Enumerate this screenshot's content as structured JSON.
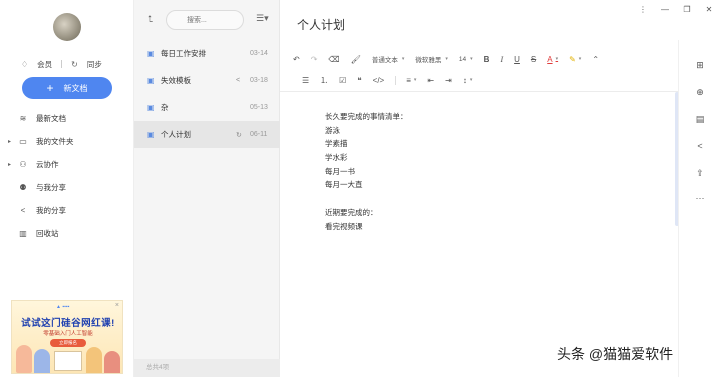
{
  "sidebar": {
    "vip_label": "会员",
    "sync_label": "同步",
    "new_doc_label": "新文档",
    "nav": [
      {
        "label": "最新文档",
        "icon": "layers-icon"
      },
      {
        "label": "我的文件夹",
        "icon": "folder-icon"
      },
      {
        "label": "云协作",
        "icon": "person-icon"
      },
      {
        "label": "与我分享",
        "icon": "people-icon"
      },
      {
        "label": "我的分享",
        "icon": "share-icon"
      },
      {
        "label": "回收站",
        "icon": "trash-icon"
      }
    ],
    "ad": {
      "title": "试试这门硅谷网红课!",
      "subtitle": "零基础入门人工智能",
      "button": "立即报名"
    }
  },
  "list": {
    "search_placeholder": "搜索...",
    "docs": [
      {
        "name": "每日工作安排",
        "date": "03-14",
        "status": ""
      },
      {
        "name": "失效模板",
        "date": "03-18",
        "status": "share"
      },
      {
        "name": "杂",
        "date": "05-13",
        "status": ""
      },
      {
        "name": "个人计划",
        "date": "06-11",
        "status": "sync"
      }
    ],
    "footer": "总共4项"
  },
  "editor": {
    "title": "个人计划",
    "toolbar": {
      "paragraph_style": "普通文本",
      "font": "微软雅黑",
      "font_size": "14"
    },
    "content": [
      "长久要完成的事情清单：",
      "游泳",
      "学素描",
      "学水彩",
      "每月一书",
      "每月一大直",
      "",
      "近期要完成的：",
      "看完视频课"
    ]
  },
  "watermark": "头条 @猫猫爱软件"
}
